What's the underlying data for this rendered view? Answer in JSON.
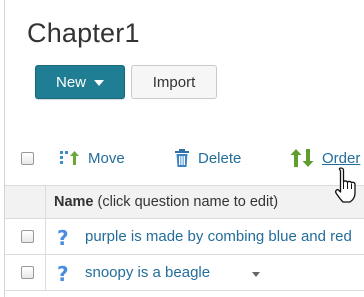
{
  "page": {
    "title": "Chapter1"
  },
  "actions": {
    "new_label": "New",
    "import_label": "Import"
  },
  "toolbar": {
    "move_label": "Move",
    "delete_label": "Delete",
    "order_label": "Order"
  },
  "table": {
    "header_name": "Name",
    "header_hint": " (click question name to edit)",
    "rows": [
      {
        "icon": "question-mark-icon",
        "text": "purple is made by combing blue and red"
      },
      {
        "icon": "question-mark-icon",
        "text": "snoopy is a beagle"
      }
    ]
  },
  "colors": {
    "primary": "#1f7e94",
    "link": "#246d9b",
    "question_icon": "#4a8ee0"
  }
}
